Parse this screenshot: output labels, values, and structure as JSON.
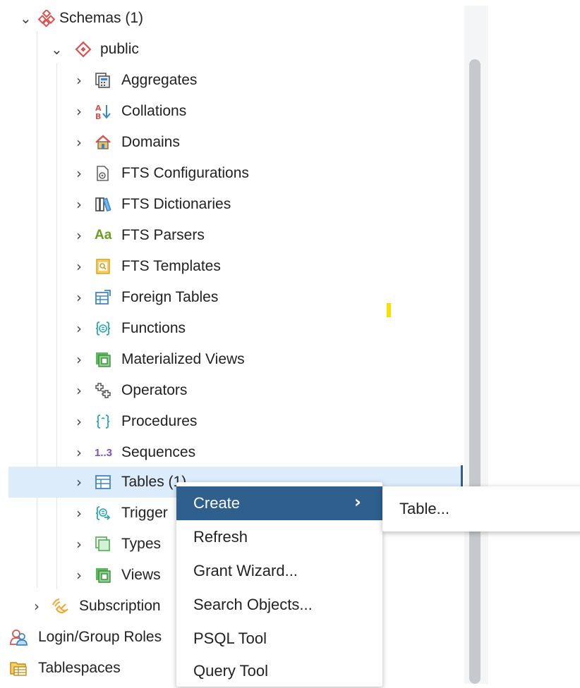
{
  "tree": {
    "schemas": {
      "label": "Schemas (1)",
      "icon": "schemas-icon"
    },
    "public": {
      "label": "public",
      "icon": "schema-public-icon"
    },
    "items": [
      {
        "label": "Aggregates",
        "icon": "aggregates-icon"
      },
      {
        "label": "Collations",
        "icon": "collations-icon"
      },
      {
        "label": "Domains",
        "icon": "domains-icon"
      },
      {
        "label": "FTS Configurations",
        "icon": "fts-configurations-icon"
      },
      {
        "label": "FTS Dictionaries",
        "icon": "fts-dictionaries-icon"
      },
      {
        "label": "FTS Parsers",
        "icon": "fts-parsers-icon",
        "icon_text": "Aa"
      },
      {
        "label": "FTS Templates",
        "icon": "fts-templates-icon"
      },
      {
        "label": "Foreign Tables",
        "icon": "foreign-tables-icon"
      },
      {
        "label": "Functions",
        "icon": "functions-icon"
      },
      {
        "label": "Materialized Views",
        "icon": "materialized-views-icon"
      },
      {
        "label": "Operators",
        "icon": "operators-icon"
      },
      {
        "label": "Procedures",
        "icon": "procedures-icon"
      },
      {
        "label": "Sequences",
        "icon": "sequences-icon",
        "icon_text": "1..3"
      },
      {
        "label": "Tables (1)",
        "icon": "tables-icon"
      },
      {
        "label": "Trigger",
        "icon": "trigger-functions-icon"
      },
      {
        "label": "Types",
        "icon": "types-icon"
      },
      {
        "label": "Views",
        "icon": "views-icon"
      }
    ],
    "subscriptions": {
      "label": "Subscription",
      "icon": "subscriptions-icon"
    },
    "login_roles": {
      "label": "Login/Group Roles",
      "icon": "login-group-roles-icon"
    },
    "tablespaces": {
      "label": "Tablespaces",
      "icon": "tablespaces-icon"
    }
  },
  "context_menu": {
    "items": [
      {
        "label": "Create",
        "has_submenu": true
      },
      {
        "label": "Refresh"
      },
      {
        "label": "Grant Wizard..."
      },
      {
        "label": "Search Objects..."
      },
      {
        "label": "PSQL Tool"
      },
      {
        "label": "Query Tool"
      }
    ],
    "submenu": {
      "items": [
        {
          "label": "Table..."
        }
      ]
    }
  },
  "colors": {
    "selection_bg": "#dcecfa",
    "menu_active": "#2f5f8d",
    "schema_red": "#d9534f",
    "green": "#5cb85c",
    "blue": "#3a87c8",
    "orange": "#f0a830",
    "teal": "#2ba7b0",
    "purple": "#7a4fcf",
    "olive": "#6b9e1f"
  }
}
